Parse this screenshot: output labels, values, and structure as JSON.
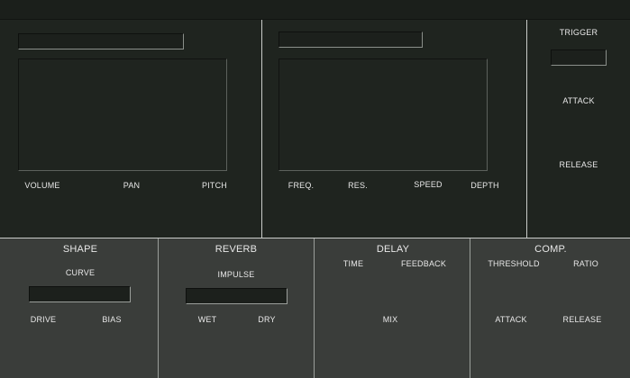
{
  "panel_a": {
    "labels": {
      "volume": "VOLUME",
      "pan": "PAN",
      "pitch": "PITCH"
    }
  },
  "panel_b": {
    "labels": {
      "freq": "FREQ.",
      "res": "RES.",
      "speed": "SPEED",
      "depth": "DEPTH"
    }
  },
  "envelope": {
    "trigger": "TRIGGER",
    "attack": "ATTACK",
    "release": "RELEASE"
  },
  "shape": {
    "title": "SHAPE",
    "curve": "CURVE",
    "drive": "DRIVE",
    "bias": "BIAS"
  },
  "reverb": {
    "title": "REVERB",
    "impulse": "IMPULSE",
    "wet": "WET",
    "dry": "DRY"
  },
  "delay": {
    "title": "DELAY",
    "time": "TIME",
    "feedback": "FEEDBACK",
    "mix": "MIX"
  },
  "comp": {
    "title": "COMP.",
    "threshold": "THRESHOLD",
    "ratio": "RATIO",
    "attack": "ATTACK",
    "release": "RELEASE"
  }
}
